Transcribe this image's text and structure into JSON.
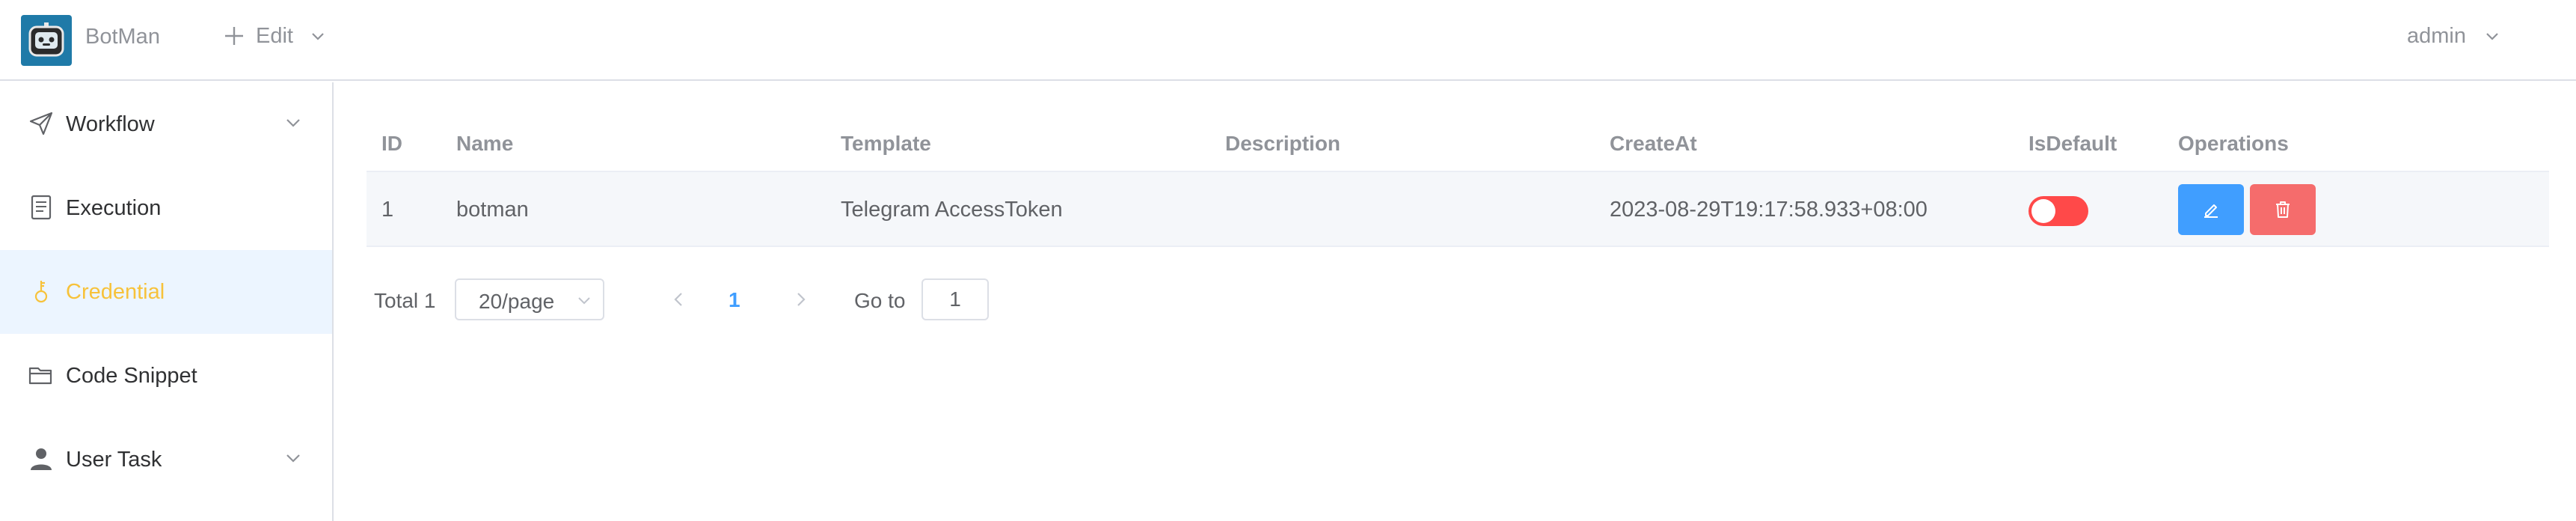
{
  "header": {
    "brand": "BotMan",
    "edit_label": "Edit",
    "user": "admin"
  },
  "sidebar": {
    "items": [
      {
        "label": "Workflow",
        "icon": "send-icon",
        "expandable": true
      },
      {
        "label": "Execution",
        "icon": "document-icon",
        "expandable": false
      },
      {
        "label": "Credential",
        "icon": "key-icon",
        "expandable": false,
        "active": true
      },
      {
        "label": "Code Snippet",
        "icon": "folder-icon",
        "expandable": false
      },
      {
        "label": "User Task",
        "icon": "user-icon",
        "expandable": true
      }
    ]
  },
  "table": {
    "columns": [
      "ID",
      "Name",
      "Template",
      "Description",
      "CreateAt",
      "IsDefault",
      "Operations"
    ],
    "rows": [
      {
        "id": "1",
        "name": "botman",
        "template": "Telegram AccessToken",
        "description": "",
        "create_at": "2023-08-29T19:17:58.933+08:00",
        "is_default": false
      }
    ]
  },
  "pagination": {
    "total": "Total 1",
    "page_size": "20/page",
    "current_page": "1",
    "goto_label": "Go to",
    "goto_value": "1"
  },
  "colors": {
    "accent_blue": "#409eff",
    "danger_red": "#f56c6c",
    "switch_off": "#ff4949",
    "active_label": "#f7c23a",
    "active_bg": "#ecf5ff"
  }
}
